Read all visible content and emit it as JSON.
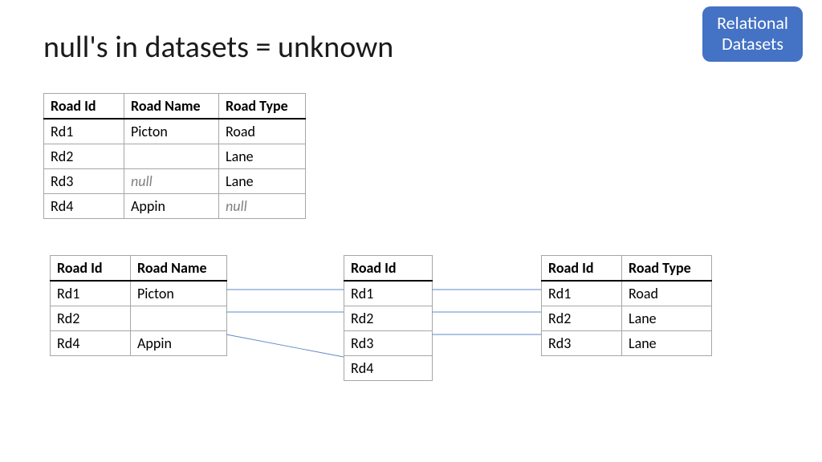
{
  "title": "null's in datasets = unknown",
  "badge": {
    "line1": "Relational",
    "line2": "Datasets"
  },
  "main": {
    "h1": "Road Id",
    "h2": "Road Name",
    "h3": "Road Type",
    "r1c1": "Rd1",
    "r1c2": "Picton",
    "r1c3": "Road",
    "r2c1": "Rd2",
    "r2c2": "",
    "r2c3": "Lane",
    "r3c1": "Rd3",
    "r3c2": "null",
    "r3c3": "Lane",
    "r4c1": "Rd4",
    "r4c2": "Appin",
    "r4c3": "null"
  },
  "left": {
    "h1": "Road Id",
    "h2": "Road Name",
    "r1c1": "Rd1",
    "r1c2": "Picton",
    "r2c1": "Rd2",
    "r2c2": "",
    "r3c1": "Rd4",
    "r3c2": "Appin"
  },
  "mid": {
    "h1": "Road Id",
    "r1c1": "Rd1",
    "r2c1": "Rd2",
    "r3c1": "Rd3",
    "r4c1": "Rd4"
  },
  "right": {
    "h1": "Road Id",
    "h2": "Road Type",
    "r1c1": "Rd1",
    "r1c2": "Road",
    "r2c1": "Rd2",
    "r2c2": "Lane",
    "r3c1": "Rd3",
    "r3c2": "Lane"
  }
}
